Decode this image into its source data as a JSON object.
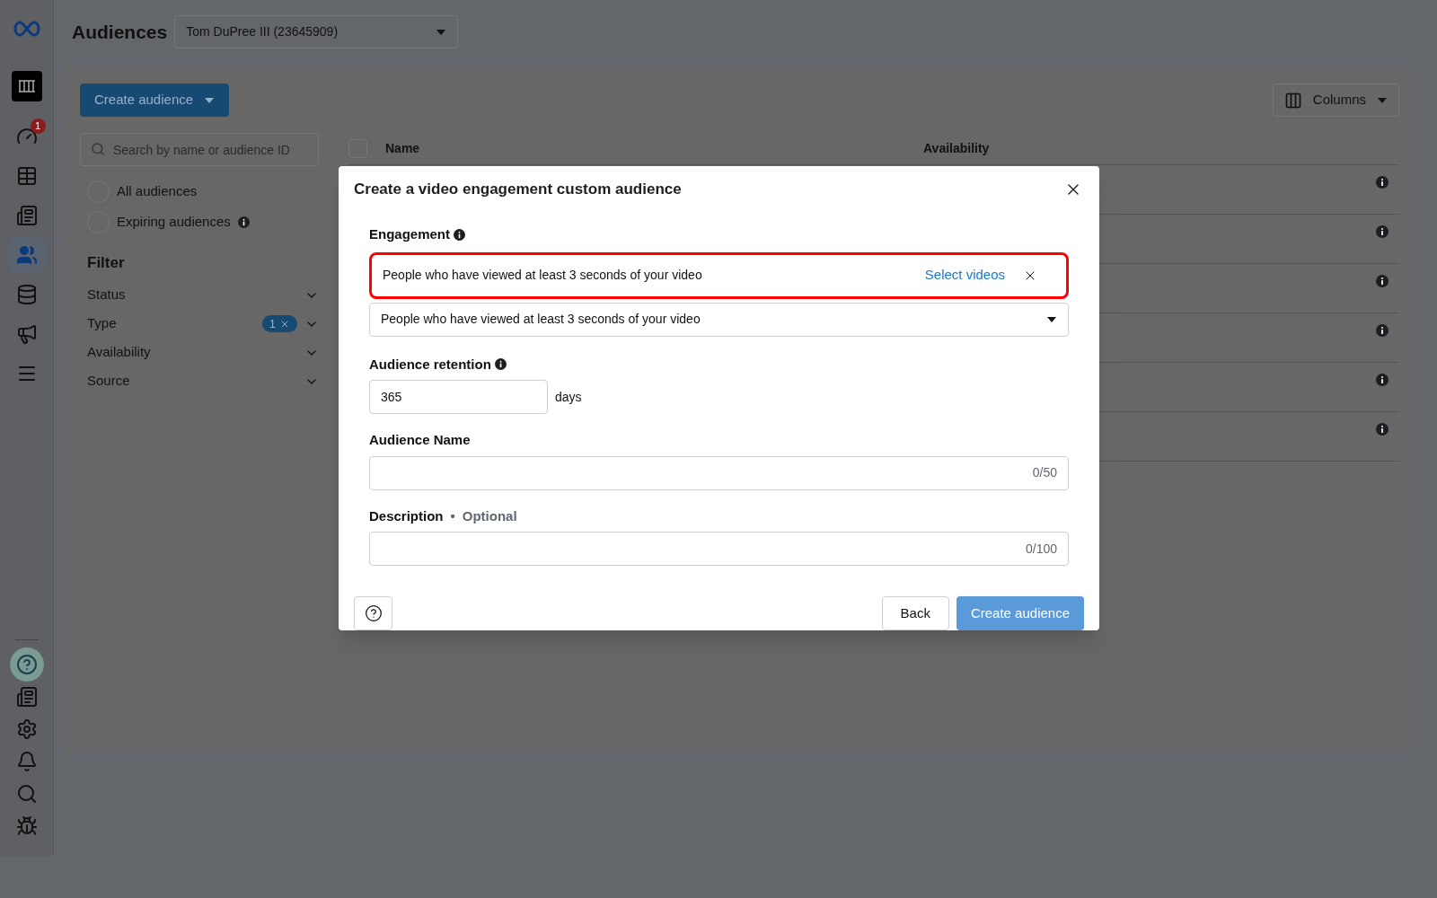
{
  "header": {
    "title": "Audiences",
    "account": "Tom DuPree III (23645909)"
  },
  "rail": {
    "top": [
      {
        "kind": "logo",
        "selected": false
      },
      {
        "kind": "app",
        "selected": false
      },
      {
        "kind": "gauge",
        "selected": false,
        "badge": "1"
      },
      {
        "kind": "table",
        "selected": false
      },
      {
        "kind": "pages",
        "selected": false
      },
      {
        "kind": "people",
        "selected": true
      },
      {
        "kind": "database",
        "selected": false
      },
      {
        "kind": "megaphone",
        "selected": false
      },
      {
        "kind": "menu",
        "selected": false
      }
    ],
    "bottom": [
      {
        "kind": "help",
        "selected": true
      },
      {
        "kind": "news",
        "selected": false
      },
      {
        "kind": "settings",
        "selected": false
      },
      {
        "kind": "bell",
        "selected": false
      },
      {
        "kind": "search",
        "selected": false
      },
      {
        "kind": "bug",
        "selected": false
      }
    ]
  },
  "toolbar": {
    "create_button": "Create audience",
    "columns_button": "Columns"
  },
  "sidebar": {
    "search": {
      "placeholder": "Search by name or audience ID"
    },
    "views": [
      {
        "label": "All audiences",
        "selected": false,
        "info": false
      },
      {
        "label": "Expiring audiences",
        "selected": false,
        "info": true
      }
    ],
    "filter_title": "Filter",
    "filters": [
      {
        "label": "Status"
      },
      {
        "label": "Type",
        "badge": "1"
      },
      {
        "label": "Availability"
      },
      {
        "label": "Source"
      }
    ]
  },
  "table": {
    "select_all": {
      "checked": false
    },
    "columns": [
      "Name",
      "Availability"
    ],
    "rows": [
      {
        "info": true
      },
      {
        "info": true
      },
      {
        "info": true
      },
      {
        "info": true
      },
      {
        "info": true
      },
      {
        "info": true
      }
    ]
  },
  "modal": {
    "title": "Create a video engagement custom audience",
    "engagement": {
      "label": "Engagement",
      "selected_option": "People who have viewed at least 3 seconds of your video",
      "action": "Select videos",
      "dropdown": "People who have viewed at least 3 seconds of your video"
    },
    "retention": {
      "label": "Audience retention",
      "value": "365",
      "unit": "days"
    },
    "name": {
      "label": "Audience Name",
      "counter": "0/50"
    },
    "description": {
      "label": "Description",
      "separator": "•",
      "optional": "Optional",
      "counter": "0/100"
    },
    "back_button": "Back",
    "create_button": {
      "label": "Create audience",
      "disabled": true
    }
  }
}
